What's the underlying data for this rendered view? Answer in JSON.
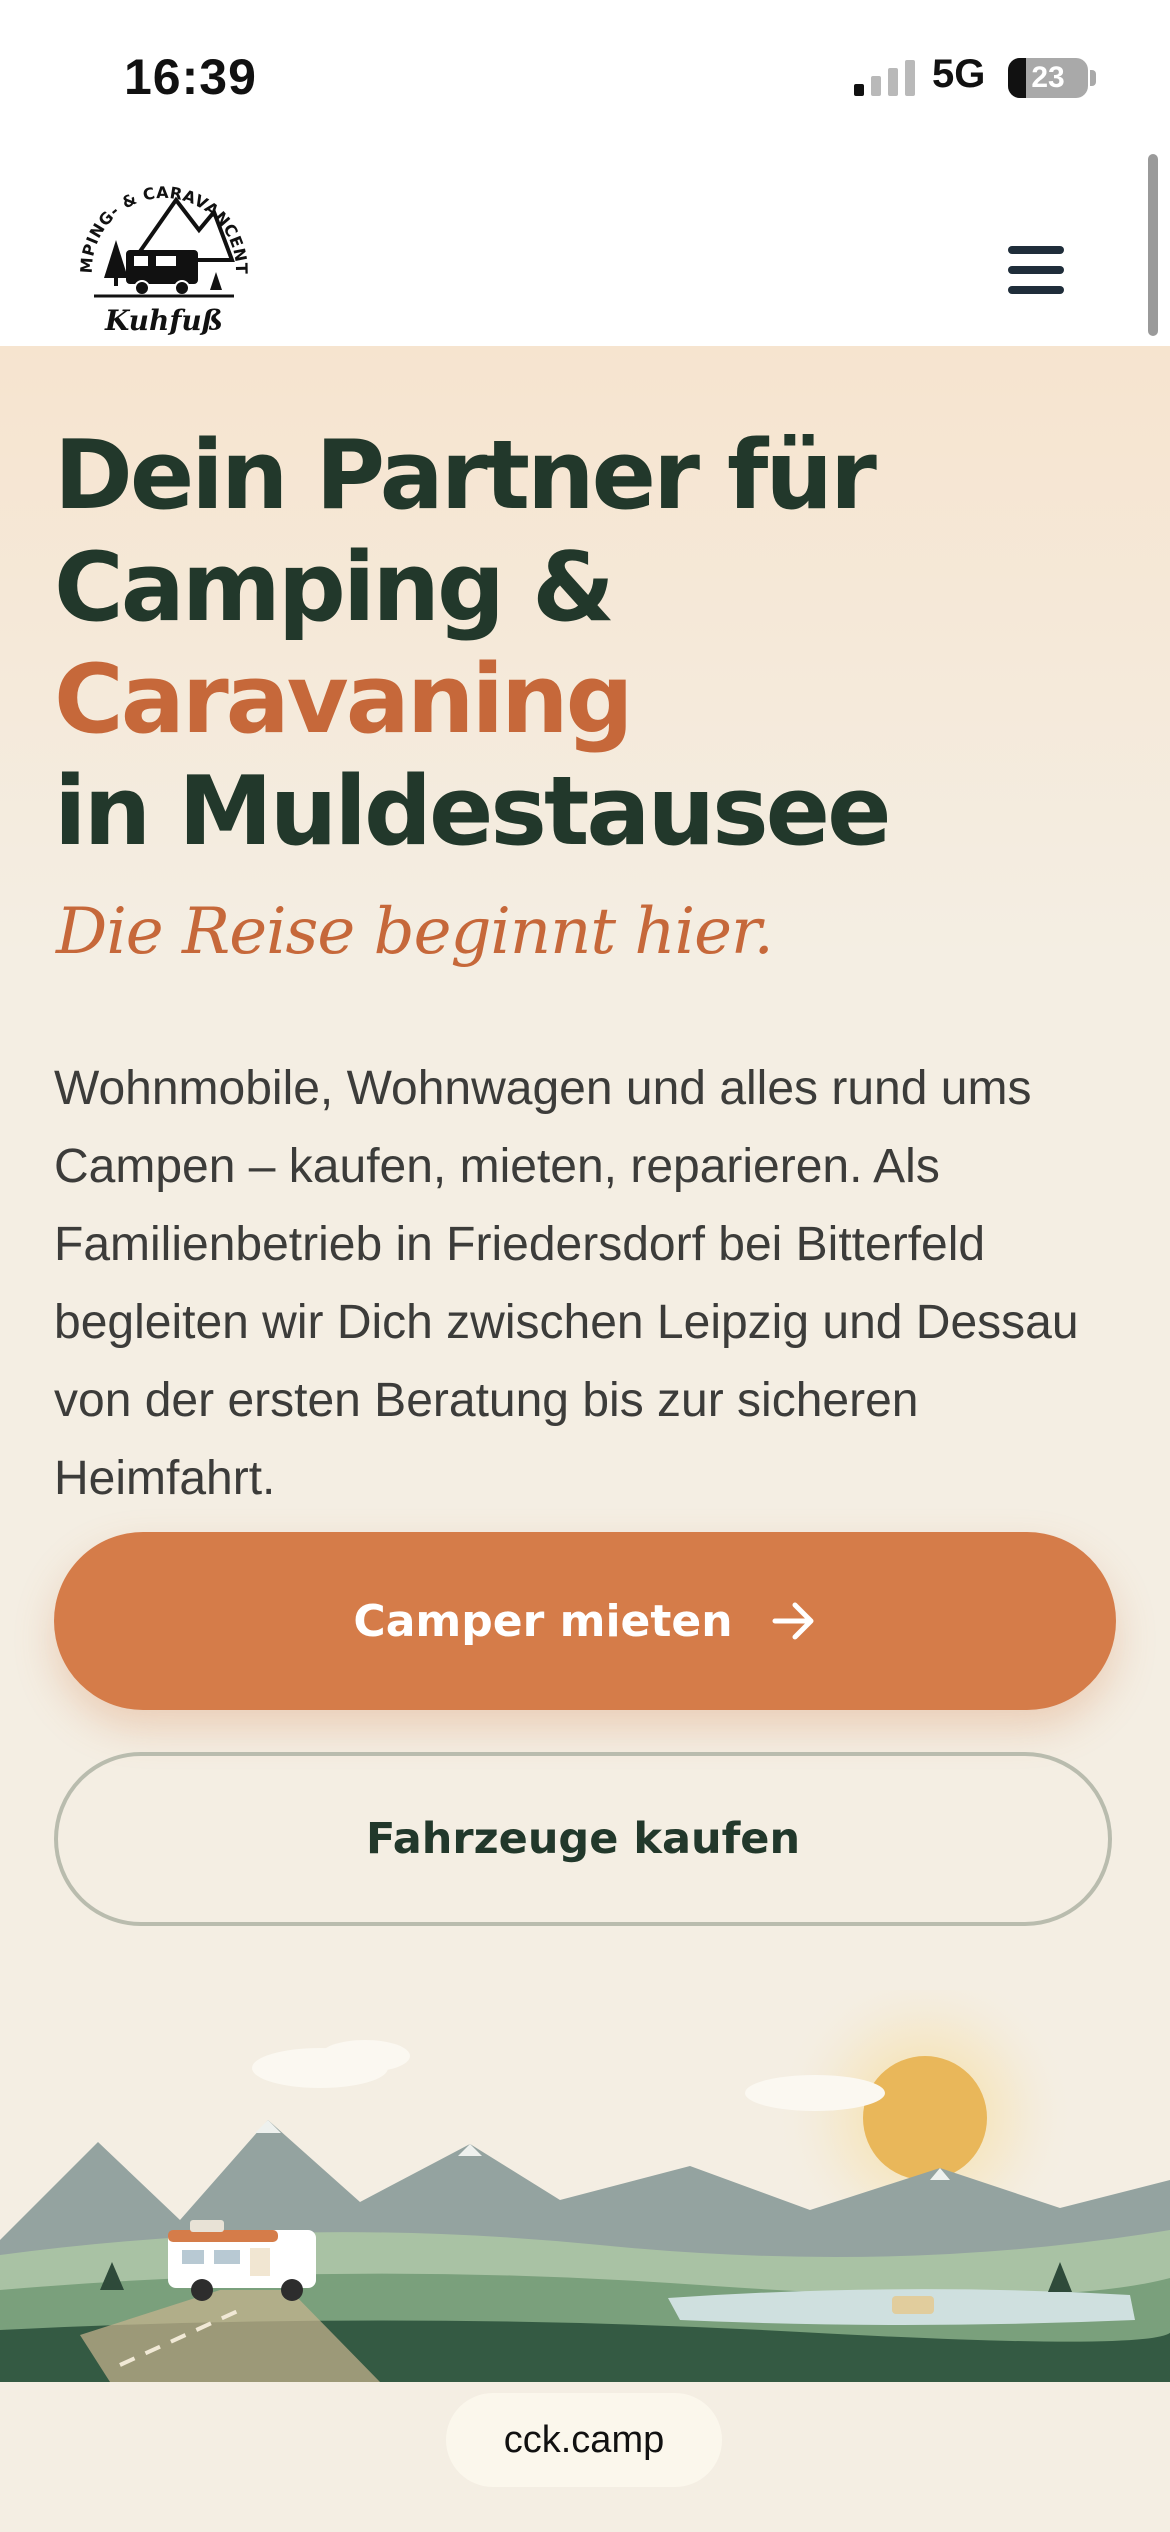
{
  "status_bar": {
    "time": "16:39",
    "network": "5G",
    "battery_percent": "23",
    "battery_level": 0.23,
    "signal_bars_active": 1,
    "signal_bars_total": 4
  },
  "header": {
    "logo": {
      "arc_text": "CAMPING- & CARAVANCENTER",
      "script_text": "Kuhfuß"
    },
    "menu_icon": "hamburger-icon"
  },
  "hero": {
    "headline_line1": "Dein Partner für",
    "headline_line2": "Camping &",
    "headline_accent": "Caravaning",
    "headline_line4": "in Muldestausee",
    "tagline": "Die Reise beginnt hier.",
    "lead": "Wohnmobile, Wohnwagen und alles rund ums Campen – kaufen, mieten, reparieren. Als Familienbetrieb in Friedersdorf bei Bitterfeld begleiten wir Dich zwischen Leipzig und Dessau von der ersten Beratung bis zur sicheren Heimfahrt.",
    "primary_button": "Camper mieten",
    "primary_button_icon": "arrow-right-icon",
    "secondary_button": "Fahrzeuge kaufen"
  },
  "colors": {
    "accent": "#d57c49",
    "heading": "#22382b",
    "accent_text": "#c6683a",
    "background": "#f4eee3"
  },
  "browser": {
    "url": "cck.camp"
  }
}
